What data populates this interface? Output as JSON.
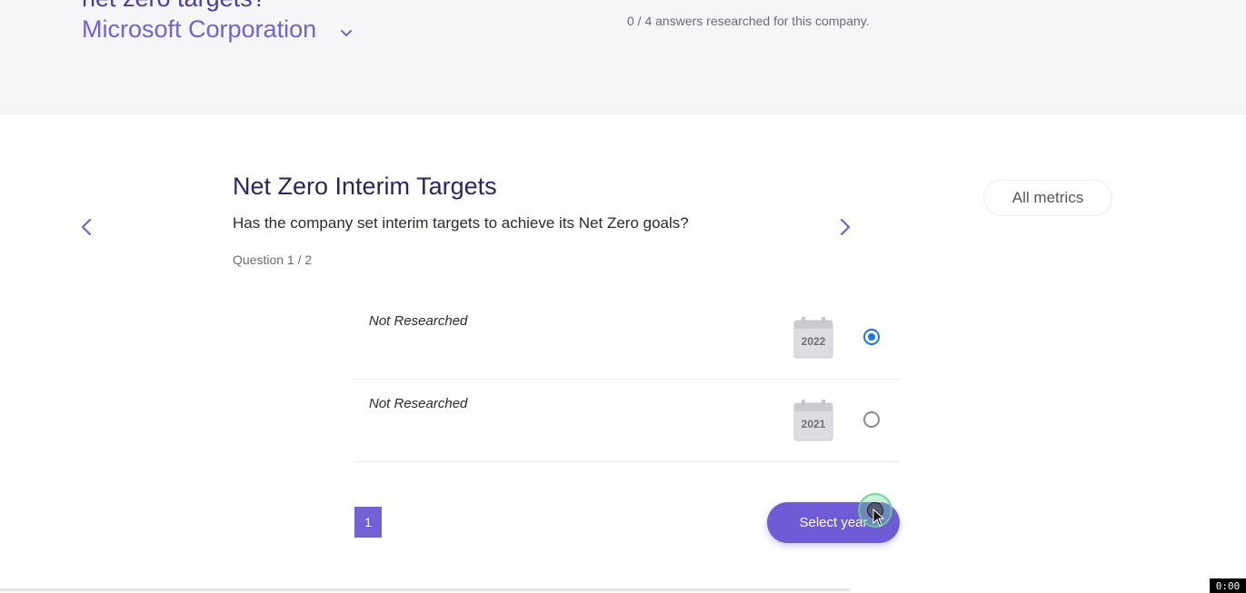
{
  "header": {
    "title": "net zero targets?",
    "company": "Microsoft Corporation",
    "answers_progress": "0 / 4 answers researched for this company."
  },
  "question": {
    "title": "Net Zero Interim Targets",
    "text": "Has the company set interim targets to achieve its Net Zero goals?",
    "counter": "Question 1 / 2"
  },
  "all_metrics_label": "All metrics",
  "answers": [
    {
      "status": "Not Researched",
      "year": "2022",
      "selected": true
    },
    {
      "status": "Not Researched",
      "year": "2021",
      "selected": false
    }
  ],
  "pagination": {
    "current_page": "1"
  },
  "select_year_label": "Select year",
  "timer": "0:00",
  "colors": {
    "accent": "#7462d4",
    "title": "#2c2363",
    "radio_selected": "#1a73e8"
  }
}
